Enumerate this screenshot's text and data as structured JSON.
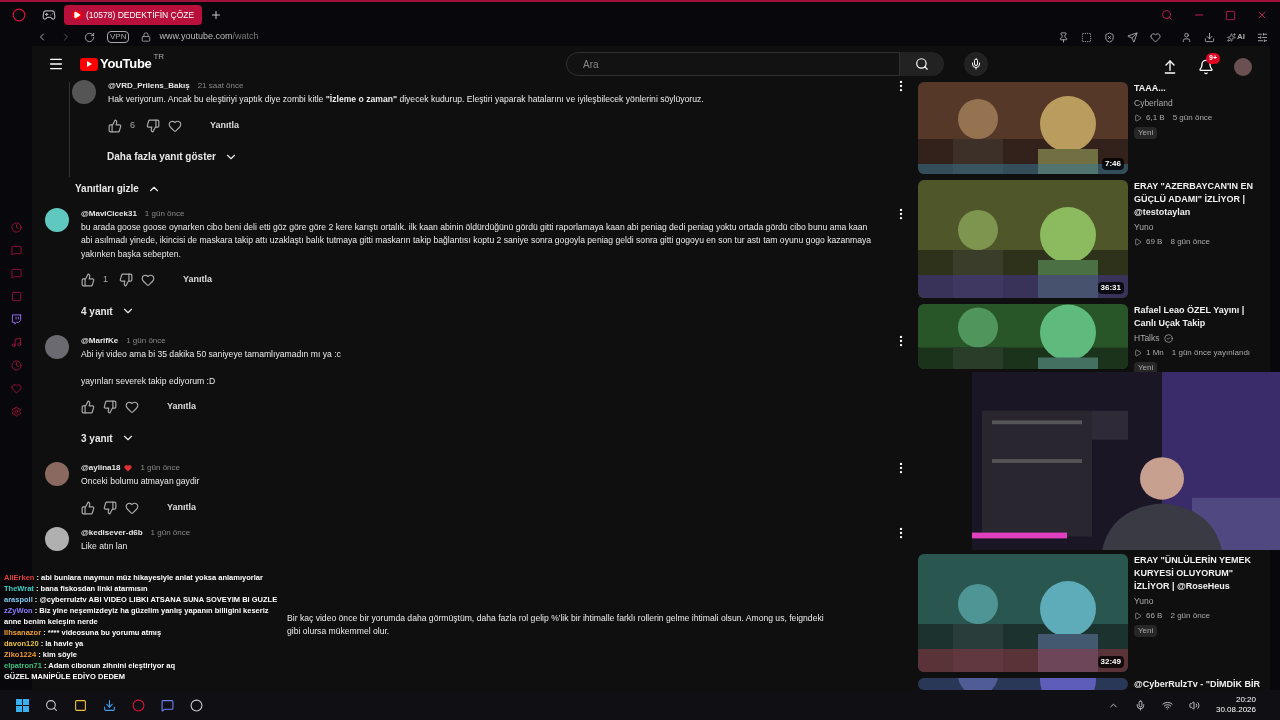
{
  "browser": {
    "tab_title": "(10578) DEDEKTİFİN ÇÖZE",
    "vpn_label": "VPN",
    "address_host": "www.youtube.com",
    "address_path": "/watch",
    "ai_label": "AI"
  },
  "youtube": {
    "logo_text": "YouTube",
    "country": "TR",
    "search_placeholder": "Ara",
    "notification_badge": "9+"
  },
  "thread": {
    "replies": [
      {
        "author": "@VRD_Prilens_Bakış",
        "time": "21 saat önce",
        "paragraphs": [
          "Hak veriyorum. Ancak bu eleştiriyi yaptık diye zombi kitle **\"İzleme o zaman\"** diyecek kudurup. Eleştiri yaparak hatalarını ve iyileşbilecek yönlerini söylüyoruz."
        ],
        "likes": "6",
        "reply_label": "Yanıtla"
      }
    ],
    "more_replies": {
      "label": "Daha fazla yanıt göster",
      "expanded": false
    },
    "hide_replies": {
      "label": "Yanıtları gizle",
      "expanded": true
    }
  },
  "comments": [
    {
      "author": "@MaviCicek31",
      "time": "1 gün önce",
      "badge": false,
      "paragraphs": [
        "bu arada goose goose oynarken cibo beni deli etti göz göre göre 2 kere karıştı ortalık. ilk kaan abinin öldürdüğünü gördü gitti raporlamaya kaan abi peniag dedi peniag yoktu ortada gördü cibo bunu ama kaan abi asılmadı yinede, ikincisi de maskara takip attı uzaklaştı balık tutmaya gitti maskarın takip bağlantısı koptu 2 saniye sonra gogoyla peniag geldi sonra gitti gogoyu en son tur astı tam oyunu gogo kazanmaya yakınken başka sebepten."
      ],
      "likes": "1",
      "reply_label": "Yanıtla",
      "replies": {
        "label": "4 yanıt",
        "expanded": false
      }
    },
    {
      "author": "@MarifKe",
      "time": "1 gün önce",
      "badge": false,
      "paragraphs": [
        "Abi iyi video ama bi 35 dakika 50 saniyeye tamamlıyamadın mı ya :c",
        "yayınları severek takip ediyorum :D"
      ],
      "reply_label": "Yanıtla",
      "replies": {
        "label": "3 yanıt",
        "expanded": false
      }
    },
    {
      "author": "@aylina18",
      "time": "1 gün önce",
      "badge": true,
      "paragraphs": [
        "Onceki bolumu atmayan gaydir"
      ],
      "reply_label": "Yanıtla"
    },
    {
      "author": "@kedisever-d6b",
      "time": "1 gün önce",
      "badge": false,
      "paragraphs": [
        "Like atın lan"
      ]
    }
  ],
  "partial_comment": {
    "text": "Bir kaç video önce bir yorumda daha görmüştüm, daha fazla rol gelip %'lik bir ihtimalle farklı rollerin gelme ihtimali olsun. Among us, feigndeki gibi olursa mükemmel olur."
  },
  "videos": [
    {
      "title": "TAAA...",
      "channel": "Cyberland",
      "verified": false,
      "views": "6,1 B",
      "age": "5 gün önce",
      "tag": "Yeni",
      "duration": "7:46"
    },
    {
      "title": "ERAY \"AZERBAYCAN'IN EN GÜÇLÜ ADAMI\" İZLİYOR | @testotaylan",
      "channel": "Yuno",
      "verified": false,
      "views": "69 B",
      "age": "8 gün önce",
      "duration": "36:31"
    },
    {
      "title": "Rafael Leao ÖZEL Yayını | Canlı Uçak Takip",
      "channel": "HTalks",
      "verified": true,
      "views": "1 Mn",
      "age": "1 gün önce yayınlandı",
      "tag": "Yeni"
    },
    {
      "title": "ERAY \"ÜNLÜLERİN YEMEK KURYESİ OLUYORUM\" İZLİYOR | @RoseHeus",
      "channel": "Yuno",
      "verified": false,
      "views": "66 B",
      "age": "2 gün önce",
      "tag": "Yeni",
      "duration": "32:49"
    },
    {
      "title": "@CyberRulzTv - \"DİMDİK BİR"
    }
  ],
  "chat": [
    {
      "user": "AliErken",
      "color": "#e0403a",
      "message": ": abi bunlara maymun müz hikayesiyle anlat yoksa anlamıyorlar"
    },
    {
      "user": "TheWrat",
      "color": "#3fd0c8",
      "message": ": bana fiskosdan linki atarmısın"
    },
    {
      "user": "araspoll",
      "color": "#7fc8f0",
      "message": ": @cyberrulztv ABI VIDEO LIBKI ATSANA SUNA SOVEYIM BI GUZLE"
    },
    {
      "user": "zZyWon",
      "color": "#8a7cff",
      "message": ": Biz yine neşemizdeyiz ha güzelim yanlış yapanın billigini keseriz anne benim keleşim nerde"
    },
    {
      "user": "Ilhsanazor",
      "color": "#f0a030",
      "message": ": **** videosuna bu yorumu atmış"
    },
    {
      "user": "davon120",
      "color": "#e8c040",
      "message": ": la havle ya"
    },
    {
      "user": "Ziko1224",
      "color": "#f09a30",
      "message": ": kim söyle"
    },
    {
      "user": "elpatron71",
      "color": "#40c080",
      "message": ": Adam cibonun zihnini eleştiriyor aq"
    },
    {
      "message": "GÜZEL MANİPÜLE EDİYO DEDEM"
    }
  ],
  "taskbar": {
    "time": "20:20",
    "date": "30.08.2026"
  }
}
